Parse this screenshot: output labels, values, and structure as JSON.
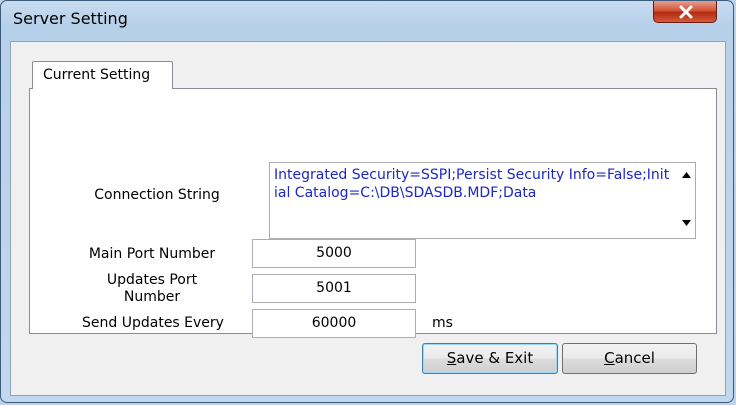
{
  "window": {
    "title": "Server Setting"
  },
  "tabs": [
    {
      "label": "Current Setting",
      "selected": true
    }
  ],
  "form": {
    "connection_string_label": "Connection String",
    "connection_string_value": "Integrated Security=SSPI;Persist Security Info=False;Initial Catalog=C:\\DB\\SDASDB.MDF;Data",
    "main_port_label": "Main Port Number",
    "main_port_value": "5000",
    "updates_port_label": "Updates Port Number",
    "updates_port_value": "5001",
    "send_updates_label": "Send Updates Every",
    "send_updates_value": "60000",
    "send_updates_unit": "ms"
  },
  "buttons": {
    "save_exit_mnemonic": "S",
    "save_exit_rest": "ave & Exit",
    "cancel_mnemonic": "C",
    "cancel_rest": "ancel"
  },
  "colors": {
    "memo_text": "#1b27c8",
    "close_button": "#c9452a"
  },
  "icons": {
    "close": "close-icon",
    "scroll_up": "scroll-up-arrow-icon",
    "scroll_down": "scroll-down-arrow-icon"
  }
}
